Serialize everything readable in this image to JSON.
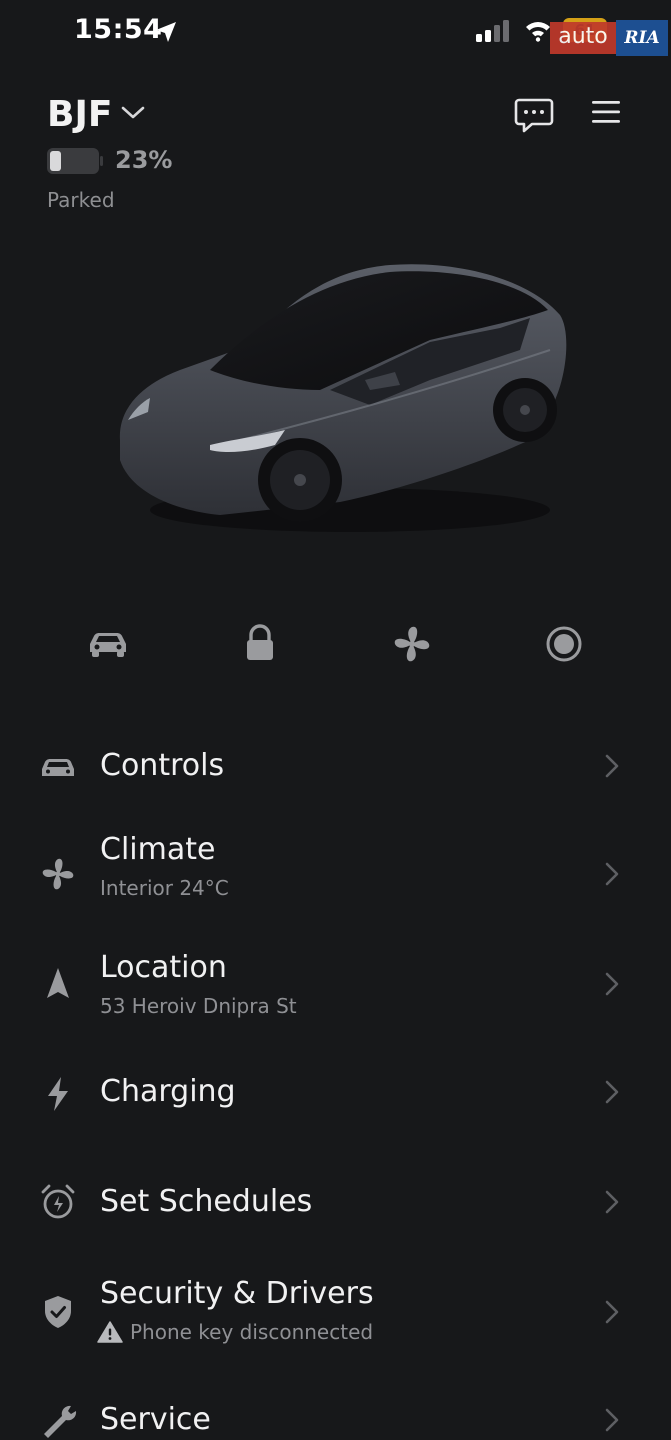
{
  "status_bar": {
    "time": "15:54",
    "battery_level": "61"
  },
  "watermark": {
    "auto": "auto",
    "ria": "RIA"
  },
  "header": {
    "vehicle_name": "BJF",
    "battery_percent": "23%",
    "battery_level": 0.23,
    "status": "Parked"
  },
  "quick_actions": [
    {
      "icon": "car-icon"
    },
    {
      "icon": "lock-icon"
    },
    {
      "icon": "fan-icon"
    },
    {
      "icon": "record-icon"
    }
  ],
  "menu": [
    {
      "title": "Controls",
      "subtitle": "",
      "icon": "car-icon"
    },
    {
      "title": "Climate",
      "subtitle": "Interior 24°C",
      "icon": "fan-icon"
    },
    {
      "title": "Location",
      "subtitle": "53 Heroiv Dnipra St",
      "icon": "navigation-arrow-icon"
    },
    {
      "title": "Charging",
      "subtitle": "",
      "icon": "bolt-icon"
    },
    {
      "title": "Set Schedules",
      "subtitle": "",
      "icon": "alarm-clock-icon"
    },
    {
      "title": "Security & Drivers",
      "subtitle": "Phone key disconnected",
      "icon": "shield-check-icon"
    },
    {
      "title": "Service",
      "subtitle": "",
      "icon": "wrench-icon"
    }
  ],
  "colors": {
    "background": "#17181a",
    "text": "#f1f1f2",
    "muted": "#8f9094",
    "icon": "#9a9b9e"
  }
}
